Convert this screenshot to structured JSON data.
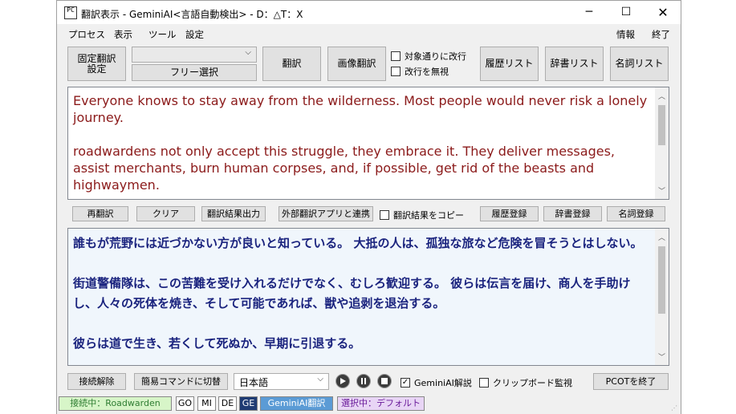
{
  "window": {
    "title": "翻訳表示 - GeminiAI<言語自動検出> - D：△T：X",
    "icon_text": "PC"
  },
  "menu": {
    "left": [
      "プロセス",
      "表示",
      "ツール",
      "設定"
    ],
    "right": [
      "情報",
      "終了"
    ]
  },
  "toolbar": {
    "fixed_translation": "固定翻訳\n設定",
    "dropdown_value": "",
    "free_select": "フリー選択",
    "translate": "翻訳",
    "image_translate": "画像翻訳",
    "check_line_break": "対象通りに改行",
    "check_ignore_line_break": "改行を無視",
    "history_list": "履歴リスト",
    "dictionary_list": "辞書リスト",
    "noun_list": "名詞リスト"
  },
  "source_text": [
    "Everyone knows to stay away from the wilderness. Most people would never risk a lonely journey.",
    "roadwardens not only accept this struggle, they embrace it. They deliver messages, assist merchants, burn human corpses, and, if possible, get rid of the beasts and highwaymen."
  ],
  "mid_toolbar": {
    "retranslate": "再翻訳",
    "clear": "クリア",
    "output_result": "翻訳結果出力",
    "external_app": "外部翻訳アプリと連携",
    "copy_result": "翻訳結果をコピー",
    "history_register": "履歴登録",
    "dictionary_register": "辞書登録",
    "noun_register": "名詞登録"
  },
  "translated_text": [
    "誰もが荒野には近づかない方が良いと知っている。 大抵の人は、孤独な旅など危険を冒そうとはしない。",
    "街道警備隊は、この苦難を受け入れるだけでなく、むしろ歓迎する。 彼らは伝言を届け、商人を手助けし、人々の死体を焼き、そして可能であれば、獣や追剥を退治する。",
    "彼らは道で生き、若くして死ぬか、早期に引退する。"
  ],
  "bottom_toolbar": {
    "disconnect": "接続解除",
    "simple_command": "簡易コマンドに切替",
    "language": "日本語",
    "gemini_explain": "GeminiAI解説",
    "gemini_explain_checked": "✓",
    "clipboard_watch": "クリップボード監視",
    "exit_pcot": "PCOTを終了"
  },
  "statusbar": {
    "connected": "接続中：Roadwarden",
    "engine_go": "GO",
    "engine_mi": "MI",
    "engine_de": "DE",
    "engine_ge": "GE",
    "engine_active": "GeminiAI翻訳",
    "selection": "選択中：デフォルト"
  },
  "colors": {
    "source_text": "#8b1a1a",
    "translated_text": "#1a237e",
    "translated_bg": "#f0f6fc",
    "status_connected_bg": "#d7f5c8",
    "status_active_bg": "#5b9bd5",
    "status_selection_bg": "#e8d5f5"
  }
}
